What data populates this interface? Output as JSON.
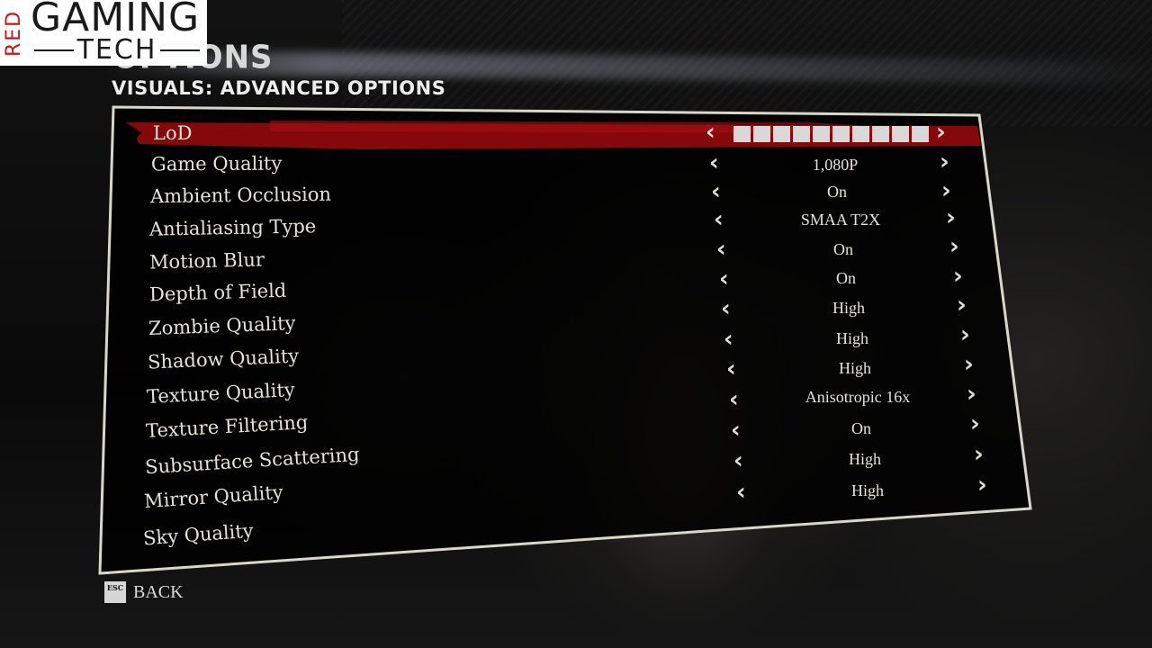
{
  "branding": {
    "red": "RED",
    "gaming": "GAMING",
    "tech": "TECH"
  },
  "header": {
    "title": "OPTIONS",
    "subtitle": "VISUALS: ADVANCED OPTIONS"
  },
  "colors": {
    "highlight": "#8c0a0c",
    "text": "#e6e2d8",
    "panel_border": "#d9d6cc",
    "logo_red": "#c8141b"
  },
  "settings": [
    {
      "label": "LoD",
      "type": "slider",
      "segments_total": 10,
      "segments_filled": 10,
      "selected": true
    },
    {
      "label": "Game Quality",
      "value": "1,080P"
    },
    {
      "label": "Ambient Occlusion",
      "value": "On"
    },
    {
      "label": "Antialiasing Type",
      "value": "SMAA T2X"
    },
    {
      "label": "Motion Blur",
      "value": "On"
    },
    {
      "label": "Depth of Field",
      "value": "On"
    },
    {
      "label": "Zombie Quality",
      "value": "High"
    },
    {
      "label": "Shadow Quality",
      "value": "High"
    },
    {
      "label": "Texture Quality",
      "value": "High"
    },
    {
      "label": "Texture Filtering",
      "value": "Anisotropic 16x"
    },
    {
      "label": "Subsurface Scattering",
      "value": "On"
    },
    {
      "label": "Mirror Quality",
      "value": "High"
    },
    {
      "label": "Sky Quality",
      "value": "High"
    }
  ],
  "arrows": {
    "left": "‹",
    "right": "›"
  },
  "footer": {
    "key": "ESC",
    "back_label": "BACK"
  }
}
